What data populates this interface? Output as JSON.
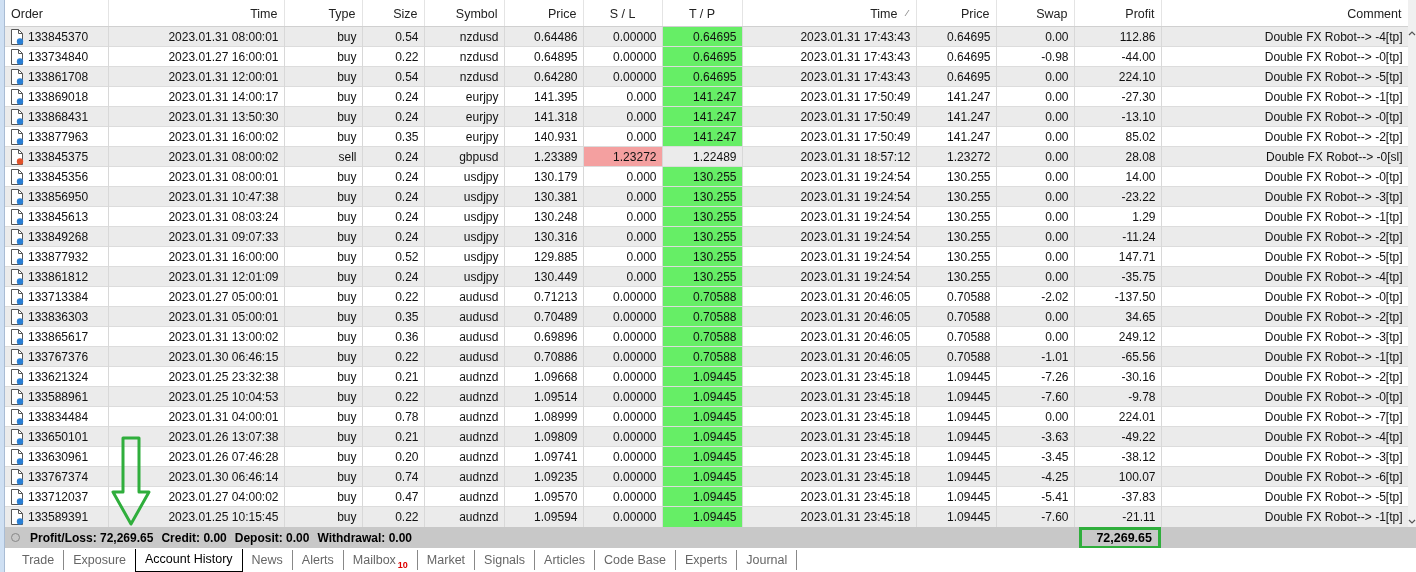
{
  "table": {
    "columns": [
      {
        "label": "Order",
        "sorted": false
      },
      {
        "label": "Time",
        "sorted": false
      },
      {
        "label": "Type",
        "sorted": false
      },
      {
        "label": "Size",
        "sorted": false
      },
      {
        "label": "Symbol",
        "sorted": false
      },
      {
        "label": "Price",
        "sorted": false
      },
      {
        "label": "S / L",
        "sorted": false
      },
      {
        "label": "T / P",
        "sorted": false
      },
      {
        "label": "Time",
        "sorted": true
      },
      {
        "label": "Price",
        "sorted": false
      },
      {
        "label": "Swap",
        "sorted": false
      },
      {
        "label": "Profit",
        "sorted": false
      },
      {
        "label": "Comment",
        "sorted": false
      }
    ],
    "rows": [
      {
        "color": "#2a7fd4",
        "stopped_out": false,
        "cells": [
          "133845370",
          "2023.01.31 08:00:01",
          "buy",
          "0.54",
          "nzdusd",
          "0.64486",
          "0.00000",
          "0.64695",
          "2023.01.31 17:43:43",
          "0.64695",
          "0.00",
          "112.86",
          "Double FX Robot--> -4[tp]"
        ]
      },
      {
        "color": "#2a7fd4",
        "stopped_out": false,
        "cells": [
          "133734840",
          "2023.01.27 16:00:01",
          "buy",
          "0.22",
          "nzdusd",
          "0.64895",
          "0.00000",
          "0.64695",
          "2023.01.31 17:43:43",
          "0.64695",
          "-0.98",
          "-44.00",
          "Double FX Robot--> -0[tp]"
        ]
      },
      {
        "color": "#2a7fd4",
        "stopped_out": false,
        "cells": [
          "133861708",
          "2023.01.31 12:00:01",
          "buy",
          "0.54",
          "nzdusd",
          "0.64280",
          "0.00000",
          "0.64695",
          "2023.01.31 17:43:43",
          "0.64695",
          "0.00",
          "224.10",
          "Double FX Robot--> -5[tp]"
        ]
      },
      {
        "color": "#2a7fd4",
        "stopped_out": false,
        "cells": [
          "133869018",
          "2023.01.31 14:00:17",
          "buy",
          "0.24",
          "eurjpy",
          "141.395",
          "0.000",
          "141.247",
          "2023.01.31 17:50:49",
          "141.247",
          "0.00",
          "-27.30",
          "Double FX Robot--> -1[tp]"
        ]
      },
      {
        "color": "#2a7fd4",
        "stopped_out": false,
        "cells": [
          "133868431",
          "2023.01.31 13:50:30",
          "buy",
          "0.24",
          "eurjpy",
          "141.318",
          "0.000",
          "141.247",
          "2023.01.31 17:50:49",
          "141.247",
          "0.00",
          "-13.10",
          "Double FX Robot--> -0[tp]"
        ]
      },
      {
        "color": "#2a7fd4",
        "stopped_out": false,
        "cells": [
          "133877963",
          "2023.01.31 16:00:02",
          "buy",
          "0.35",
          "eurjpy",
          "140.931",
          "0.000",
          "141.247",
          "2023.01.31 17:50:49",
          "141.247",
          "0.00",
          "85.02",
          "Double FX Robot--> -2[tp]"
        ]
      },
      {
        "color": "#e2522a",
        "stopped_out": true,
        "cells": [
          "133845375",
          "2023.01.31 08:00:02",
          "sell",
          "0.24",
          "gbpusd",
          "1.23389",
          "1.23272",
          "1.22489",
          "2023.01.31 18:57:12",
          "1.23272",
          "0.00",
          "28.08",
          "Double FX Robot--> -0[sl]"
        ]
      },
      {
        "color": "#2a7fd4",
        "stopped_out": false,
        "cells": [
          "133845356",
          "2023.01.31 08:00:01",
          "buy",
          "0.24",
          "usdjpy",
          "130.179",
          "0.000",
          "130.255",
          "2023.01.31 19:24:54",
          "130.255",
          "0.00",
          "14.00",
          "Double FX Robot--> -0[tp]"
        ]
      },
      {
        "color": "#2a7fd4",
        "stopped_out": false,
        "cells": [
          "133856950",
          "2023.01.31 10:47:38",
          "buy",
          "0.24",
          "usdjpy",
          "130.381",
          "0.000",
          "130.255",
          "2023.01.31 19:24:54",
          "130.255",
          "0.00",
          "-23.22",
          "Double FX Robot--> -3[tp]"
        ]
      },
      {
        "color": "#2a7fd4",
        "stopped_out": false,
        "cells": [
          "133845613",
          "2023.01.31 08:03:24",
          "buy",
          "0.24",
          "usdjpy",
          "130.248",
          "0.000",
          "130.255",
          "2023.01.31 19:24:54",
          "130.255",
          "0.00",
          "1.29",
          "Double FX Robot--> -1[tp]"
        ]
      },
      {
        "color": "#2a7fd4",
        "stopped_out": false,
        "cells": [
          "133849268",
          "2023.01.31 09:07:33",
          "buy",
          "0.24",
          "usdjpy",
          "130.316",
          "0.000",
          "130.255",
          "2023.01.31 19:24:54",
          "130.255",
          "0.00",
          "-11.24",
          "Double FX Robot--> -2[tp]"
        ]
      },
      {
        "color": "#2a7fd4",
        "stopped_out": false,
        "cells": [
          "133877932",
          "2023.01.31 16:00:00",
          "buy",
          "0.52",
          "usdjpy",
          "129.885",
          "0.000",
          "130.255",
          "2023.01.31 19:24:54",
          "130.255",
          "0.00",
          "147.71",
          "Double FX Robot--> -5[tp]"
        ]
      },
      {
        "color": "#2a7fd4",
        "stopped_out": false,
        "cells": [
          "133861812",
          "2023.01.31 12:01:09",
          "buy",
          "0.24",
          "usdjpy",
          "130.449",
          "0.000",
          "130.255",
          "2023.01.31 19:24:54",
          "130.255",
          "0.00",
          "-35.75",
          "Double FX Robot--> -4[tp]"
        ]
      },
      {
        "color": "#2a7fd4",
        "stopped_out": false,
        "cells": [
          "133713384",
          "2023.01.27 05:00:01",
          "buy",
          "0.22",
          "audusd",
          "0.71213",
          "0.00000",
          "0.70588",
          "2023.01.31 20:46:05",
          "0.70588",
          "-2.02",
          "-137.50",
          "Double FX Robot--> -0[tp]"
        ]
      },
      {
        "color": "#2a7fd4",
        "stopped_out": false,
        "cells": [
          "133836303",
          "2023.01.31 05:00:01",
          "buy",
          "0.35",
          "audusd",
          "0.70489",
          "0.00000",
          "0.70588",
          "2023.01.31 20:46:05",
          "0.70588",
          "0.00",
          "34.65",
          "Double FX Robot--> -2[tp]"
        ]
      },
      {
        "color": "#2a7fd4",
        "stopped_out": false,
        "cells": [
          "133865617",
          "2023.01.31 13:00:02",
          "buy",
          "0.36",
          "audusd",
          "0.69896",
          "0.00000",
          "0.70588",
          "2023.01.31 20:46:05",
          "0.70588",
          "0.00",
          "249.12",
          "Double FX Robot--> -3[tp]"
        ]
      },
      {
        "color": "#2a7fd4",
        "stopped_out": false,
        "cells": [
          "133767376",
          "2023.01.30 06:46:15",
          "buy",
          "0.22",
          "audusd",
          "0.70886",
          "0.00000",
          "0.70588",
          "2023.01.31 20:46:05",
          "0.70588",
          "-1.01",
          "-65.56",
          "Double FX Robot--> -1[tp]"
        ]
      },
      {
        "color": "#2a7fd4",
        "stopped_out": false,
        "cells": [
          "133621324",
          "2023.01.25 23:32:38",
          "buy",
          "0.21",
          "audnzd",
          "1.09668",
          "0.00000",
          "1.09445",
          "2023.01.31 23:45:18",
          "1.09445",
          "-7.26",
          "-30.16",
          "Double FX Robot--> -2[tp]"
        ]
      },
      {
        "color": "#2a7fd4",
        "stopped_out": false,
        "cells": [
          "133588961",
          "2023.01.25 10:04:53",
          "buy",
          "0.22",
          "audnzd",
          "1.09514",
          "0.00000",
          "1.09445",
          "2023.01.31 23:45:18",
          "1.09445",
          "-7.60",
          "-9.78",
          "Double FX Robot--> -0[tp]"
        ]
      },
      {
        "color": "#2a7fd4",
        "stopped_out": false,
        "cells": [
          "133834484",
          "2023.01.31 04:00:01",
          "buy",
          "0.78",
          "audnzd",
          "1.08999",
          "0.00000",
          "1.09445",
          "2023.01.31 23:45:18",
          "1.09445",
          "0.00",
          "224.01",
          "Double FX Robot--> -7[tp]"
        ]
      },
      {
        "color": "#2a7fd4",
        "stopped_out": false,
        "cells": [
          "133650101",
          "2023.01.26 13:07:38",
          "buy",
          "0.21",
          "audnzd",
          "1.09809",
          "0.00000",
          "1.09445",
          "2023.01.31 23:45:18",
          "1.09445",
          "-3.63",
          "-49.22",
          "Double FX Robot--> -4[tp]"
        ]
      },
      {
        "color": "#2a7fd4",
        "stopped_out": false,
        "cells": [
          "133630961",
          "2023.01.26 07:46:28",
          "buy",
          "0.20",
          "audnzd",
          "1.09741",
          "0.00000",
          "1.09445",
          "2023.01.31 23:45:18",
          "1.09445",
          "-3.45",
          "-38.12",
          "Double FX Robot--> -3[tp]"
        ]
      },
      {
        "color": "#2a7fd4",
        "stopped_out": false,
        "cells": [
          "133767374",
          "2023.01.30 06:46:14",
          "buy",
          "0.74",
          "audnzd",
          "1.09235",
          "0.00000",
          "1.09445",
          "2023.01.31 23:45:18",
          "1.09445",
          "-4.25",
          "100.07",
          "Double FX Robot--> -6[tp]"
        ]
      },
      {
        "color": "#2a7fd4",
        "stopped_out": false,
        "cells": [
          "133712037",
          "2023.01.27 04:00:02",
          "buy",
          "0.47",
          "audnzd",
          "1.09570",
          "0.00000",
          "1.09445",
          "2023.01.31 23:45:18",
          "1.09445",
          "-5.41",
          "-37.83",
          "Double FX Robot--> -5[tp]"
        ]
      },
      {
        "color": "#2a7fd4",
        "stopped_out": false,
        "cells": [
          "133589391",
          "2023.01.25 10:15:45",
          "buy",
          "0.22",
          "audnzd",
          "1.09594",
          "0.00000",
          "1.09445",
          "2023.01.31 23:45:18",
          "1.09445",
          "-7.60",
          "-21.11",
          "Double FX Robot--> -1[tp]"
        ]
      }
    ]
  },
  "summary": {
    "items": [
      "Profit/Loss: 72,269.65",
      "Credit: 0.00",
      "Deposit: 0.00",
      "Withdrawal: 0.00"
    ],
    "total": "72,269.65",
    "total_highlighted": true,
    "arrow": true
  },
  "tabs": [
    {
      "label": "Trade",
      "selected": false
    },
    {
      "label": "Exposure",
      "selected": false
    },
    {
      "label": "Account History",
      "selected": true
    },
    {
      "label": "News",
      "selected": false
    },
    {
      "label": "Alerts",
      "selected": false
    },
    {
      "label": "Mailbox",
      "badge": "10",
      "selected": false
    },
    {
      "label": "Market",
      "selected": false
    },
    {
      "label": "Signals",
      "selected": false
    },
    {
      "label": "Articles",
      "selected": false
    },
    {
      "label": "Code Base",
      "selected": false
    },
    {
      "label": "Experts",
      "selected": false
    },
    {
      "label": "Journal",
      "selected": false
    }
  ]
}
